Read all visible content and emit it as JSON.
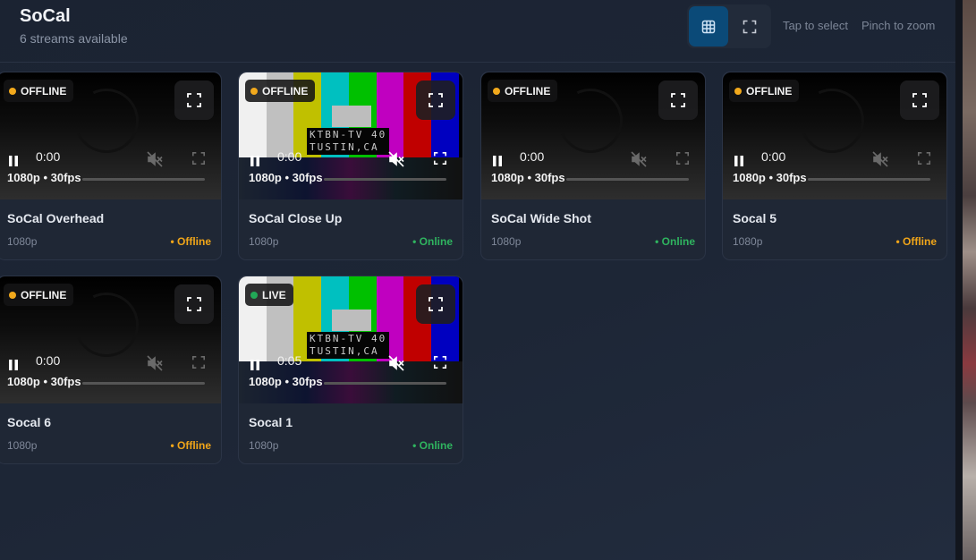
{
  "header": {
    "title": "SoCal",
    "subtitle": "6 streams available",
    "hint_select": "Tap to select",
    "hint_zoom": "Pinch to zoom"
  },
  "testcard": {
    "line1": "KTBN-TV 40",
    "line2": "TUSTIN,CA"
  },
  "cards": [
    {
      "name": "SoCal Overhead",
      "resolution": "1080p",
      "status": "• Offline",
      "badge": "OFFLINE",
      "time": "0:00",
      "spec": "1080p • 30fps",
      "feed": "offline"
    },
    {
      "name": "SoCal Close Up",
      "resolution": "1080p",
      "status": "• Online",
      "badge": "OFFLINE",
      "time": "0:00",
      "spec": "1080p • 30fps",
      "feed": "testcard"
    },
    {
      "name": "SoCal Wide Shot",
      "resolution": "1080p",
      "status": "• Online",
      "badge": "OFFLINE",
      "time": "0:00",
      "spec": "1080p • 30fps",
      "feed": "offline"
    },
    {
      "name": "Socal 5",
      "resolution": "1080p",
      "status": "• Offline",
      "badge": "OFFLINE",
      "time": "0:00",
      "spec": "1080p • 30fps",
      "feed": "offline"
    },
    {
      "name": "Socal 6",
      "resolution": "1080p",
      "status": "• Offline",
      "badge": "OFFLINE",
      "time": "0:00",
      "spec": "1080p • 30fps",
      "feed": "offline"
    },
    {
      "name": "Socal 1",
      "resolution": "1080p",
      "status": "• Online",
      "badge": "LIVE",
      "time": "0:05",
      "spec": "1080p • 30fps",
      "feed": "testcard"
    }
  ],
  "colors": {
    "accent": "#0b4a78",
    "offline": "#f0a519",
    "online": "#2fb45f",
    "background": "#1b2332"
  },
  "icons": {
    "grid_view": "grid-icon",
    "single_view": "expand-icon",
    "fullscreen": "fullscreen-icon",
    "pause": "pause-icon",
    "mute": "muted-speaker-icon"
  }
}
